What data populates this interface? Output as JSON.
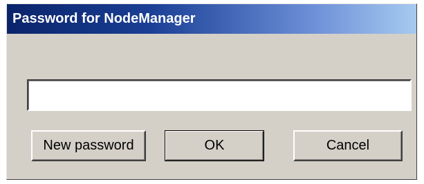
{
  "window": {
    "title": "Password for NodeManager"
  },
  "password_field": {
    "value": ""
  },
  "buttons": {
    "new_password": "New password",
    "ok": "OK",
    "cancel": "Cancel"
  },
  "colors": {
    "titlebar_start": "#0a246a",
    "titlebar_end": "#a6caf0",
    "dialog_face": "#d4d0c8"
  }
}
